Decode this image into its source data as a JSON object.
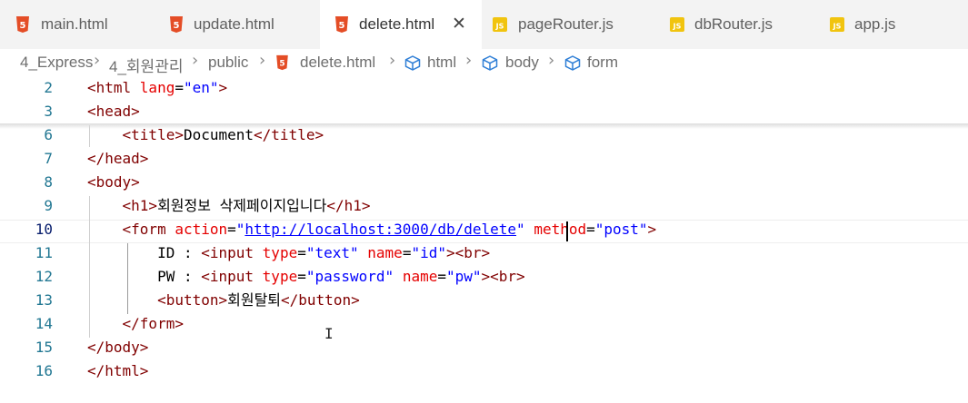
{
  "tabs": [
    {
      "label": "main.html",
      "icon": "html5-icon",
      "badge": "5"
    },
    {
      "label": "update.html",
      "icon": "html5-icon",
      "badge": "5"
    },
    {
      "label": "delete.html",
      "icon": "html5-icon",
      "badge": "5",
      "active": true,
      "close": "✕"
    },
    {
      "label": "pageRouter.js",
      "icon": "js-file-icon",
      "badge": "JS"
    },
    {
      "label": "dbRouter.js",
      "icon": "js-file-icon",
      "badge": "JS"
    },
    {
      "label": "app.js",
      "icon": "js-file-icon",
      "badge": "JS"
    }
  ],
  "breadcrumb": {
    "items": [
      "4_Express",
      "4_회원관리",
      "public",
      "delete.html",
      "html",
      "body",
      "form"
    ],
    "separator": "›",
    "html_badge": "5"
  },
  "lines": [
    {
      "n": "2",
      "t": [
        [
          "tg",
          "<html "
        ],
        [
          "at",
          "lang"
        ],
        [
          "",
          "="
        ],
        [
          "st",
          "\"en\""
        ],
        [
          "tg",
          ">"
        ]
      ]
    },
    {
      "n": "3",
      "t": [
        [
          "tg",
          "<head>"
        ]
      ]
    },
    {
      "n": "6",
      "t": [
        [
          "",
          "    "
        ],
        [
          "tg",
          "<title>"
        ],
        [
          "",
          "Document"
        ],
        [
          "tg",
          "</title>"
        ]
      ]
    },
    {
      "n": "7",
      "t": [
        [
          "tg",
          "</head>"
        ]
      ]
    },
    {
      "n": "8",
      "t": [
        [
          "tg",
          "<body>"
        ]
      ]
    },
    {
      "n": "9",
      "t": [
        [
          "",
          "    "
        ],
        [
          "tg",
          "<h1>"
        ],
        [
          "",
          "회원정보 삭제페이지입니다"
        ],
        [
          "tg",
          "</h1>"
        ]
      ]
    },
    {
      "n": "10",
      "t": [
        [
          "",
          "    "
        ],
        [
          "tg",
          "<form "
        ],
        [
          "at",
          "action"
        ],
        [
          "",
          "="
        ],
        [
          "st",
          "\""
        ],
        [
          "url",
          "http://localhost:3000/db/delete"
        ],
        [
          "st",
          "\""
        ],
        [
          "",
          " "
        ],
        [
          "at",
          "method"
        ],
        [
          "",
          "="
        ],
        [
          "st",
          "\"post\""
        ],
        [
          "tg",
          ">"
        ]
      ]
    },
    {
      "n": "11",
      "t": [
        [
          "",
          "        ID : "
        ],
        [
          "tg",
          "<input "
        ],
        [
          "at",
          "type"
        ],
        [
          "",
          "="
        ],
        [
          "st",
          "\"text\""
        ],
        [
          "",
          " "
        ],
        [
          "at",
          "name"
        ],
        [
          "",
          "="
        ],
        [
          "st",
          "\"id\""
        ],
        [
          "tg",
          ">"
        ],
        [
          "tg",
          "<br>"
        ]
      ]
    },
    {
      "n": "12",
      "t": [
        [
          "",
          "        PW : "
        ],
        [
          "tg",
          "<input "
        ],
        [
          "at",
          "type"
        ],
        [
          "",
          "="
        ],
        [
          "st",
          "\"password\""
        ],
        [
          "",
          " "
        ],
        [
          "at",
          "name"
        ],
        [
          "",
          "="
        ],
        [
          "st",
          "\"pw\""
        ],
        [
          "tg",
          ">"
        ],
        [
          "tg",
          "<br>"
        ]
      ]
    },
    {
      "n": "13",
      "t": [
        [
          "",
          "        "
        ],
        [
          "tg",
          "<button>"
        ],
        [
          "",
          "회원탈퇴"
        ],
        [
          "tg",
          "</button>"
        ]
      ]
    },
    {
      "n": "14",
      "t": [
        [
          "",
          "    "
        ],
        [
          "tg",
          "</form>"
        ]
      ]
    },
    {
      "n": "15",
      "t": [
        [
          "tg",
          "</body>"
        ]
      ]
    },
    {
      "n": "16",
      "t": [
        [
          "tg",
          "</html>"
        ]
      ]
    }
  ],
  "current_line": "10",
  "colors": {
    "html_icon": "#e44d26",
    "js_icon": "#f1c40f",
    "json_icon": "#3c7bd4",
    "tag": "#800000",
    "attribute": "#e50000",
    "string": "#0000ff",
    "line_number": "#237893"
  }
}
